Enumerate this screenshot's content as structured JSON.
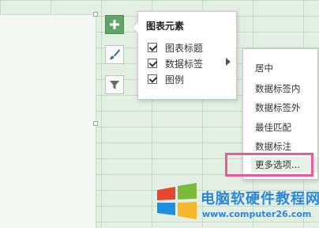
{
  "panel": {
    "title": "图表元素",
    "options": [
      {
        "label": "图表标题",
        "checked": true
      },
      {
        "label": "数据标签",
        "checked": true
      },
      {
        "label": "图例",
        "checked": true
      }
    ]
  },
  "submenu": {
    "items": [
      "居中",
      "数据标签内",
      "数据标签外",
      "最佳匹配",
      "数据标注",
      "更多选项..."
    ],
    "highlighted_index": 5
  },
  "side_buttons": [
    {
      "icon": "plus-icon",
      "active": true
    },
    {
      "icon": "brush-icon",
      "active": false
    },
    {
      "icon": "filter-icon",
      "active": false
    }
  ],
  "watermark": {
    "name": "电脑软硬件教程网",
    "url": "www.computer26.com"
  },
  "colors": {
    "accent_green": "#61a465",
    "highlight_pink": "#e85a98",
    "watermark_blue": "#2a86d8"
  }
}
